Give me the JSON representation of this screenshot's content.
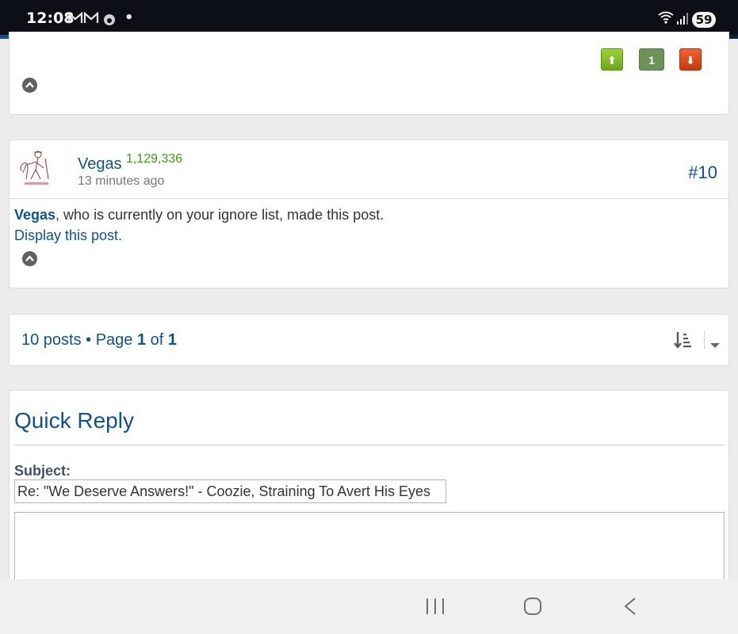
{
  "status": {
    "time": "12:08",
    "notifications": "M M",
    "dot": "•",
    "battery": "59"
  },
  "progress": {
    "fraction": 0.92
  },
  "post9": {
    "vote_up": "⬆",
    "score": "1",
    "vote_down": "⬇"
  },
  "post10": {
    "username": "Vegas",
    "post_count": "1,129,336",
    "time_ago": "13 minutes ago",
    "number": "#10",
    "ignore_user": "Vegas",
    "ignore_text": ", who is currently on your ignore list, made this post.",
    "display_link": "Display this post",
    "display_suffix": "."
  },
  "pagination": {
    "posts_text": "10 posts • Page ",
    "current": "1",
    "of_text": " of ",
    "total": "1"
  },
  "quick_reply": {
    "title": "Quick Reply",
    "subject_label": "Subject:",
    "subject_value": "Re: \"We Deserve Answers!\" -  Coozie,  Straining To Avert His Eyes"
  },
  "colors": {
    "link": "#105289",
    "post_count": "#3c9b1a",
    "vote_up": "#7cb91f",
    "vote_score": "#6d9257",
    "vote_down": "#d7441a"
  },
  "icons": {
    "back_to_top": "chevron-up-circle-icon",
    "sort": "sort-descending-icon",
    "dropdown": "caret-down-icon",
    "nav_recent": "recent-apps-icon",
    "nav_home": "home-icon",
    "nav_back": "back-icon"
  }
}
